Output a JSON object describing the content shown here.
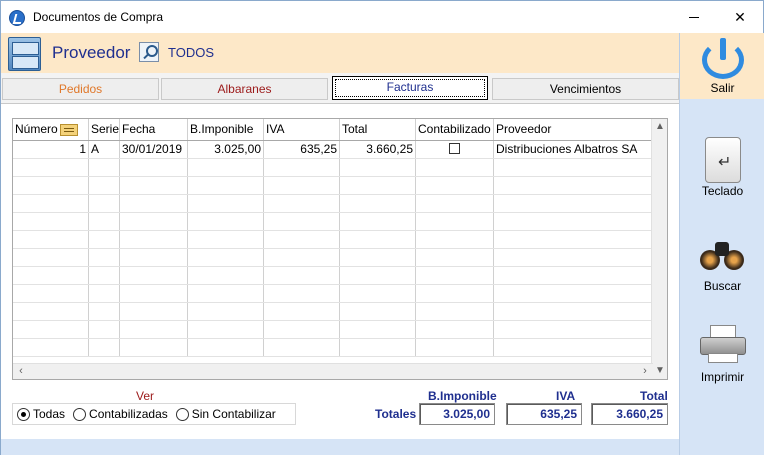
{
  "window": {
    "title": "Documentos de Compra"
  },
  "header": {
    "label": "Proveedor",
    "value": "TODOS"
  },
  "tabs": [
    {
      "label": "Pedidos"
    },
    {
      "label": "Albaranes"
    },
    {
      "label": "Facturas"
    },
    {
      "label": "Vencimientos"
    }
  ],
  "active_tab": "Facturas",
  "table": {
    "columns": [
      "Número",
      "Serie",
      "Fecha",
      "B.Imponible",
      "IVA",
      "Total",
      "Contabilizado",
      "Proveedor"
    ],
    "rows": [
      {
        "numero": "1",
        "serie": "A",
        "fecha": "30/01/2019",
        "base": "3.025,00",
        "iva": "635,25",
        "total": "3.660,25",
        "contabilizado": false,
        "proveedor": "Distribuciones Albatros SA"
      }
    ]
  },
  "filter": {
    "label": "Ver",
    "options": [
      "Todas",
      "Contabilizadas",
      "Sin Contabilizar"
    ],
    "selected": "Todas"
  },
  "totals": {
    "label": "Totales",
    "headers": {
      "base": "B.Imponible",
      "iva": "IVA",
      "total": "Total"
    },
    "values": {
      "base": "3.025,00",
      "iva": "635,25",
      "total": "3.660,25"
    }
  },
  "side_actions": {
    "exit": "Salir",
    "keyboard": "Teclado",
    "search": "Buscar",
    "print": "Imprimir"
  },
  "icons": [
    "app-icon",
    "drawer-icon",
    "search-icon",
    "power-icon",
    "keyboard-icon",
    "binoculars-icon",
    "printer-icon",
    "card-icon"
  ]
}
